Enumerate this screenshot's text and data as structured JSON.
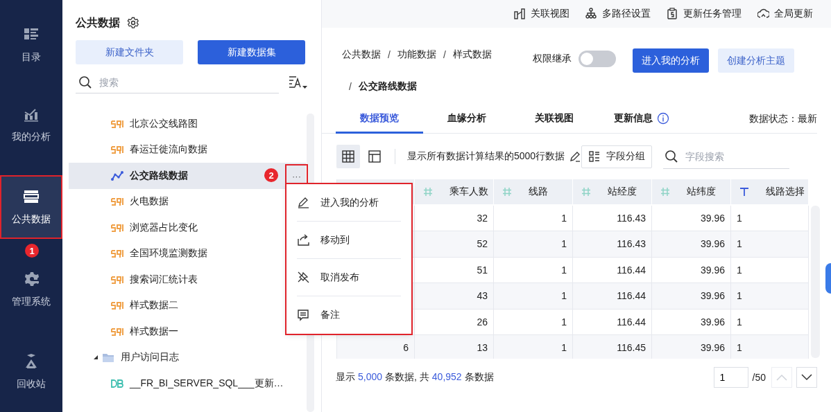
{
  "nav": [
    {
      "label": "目录",
      "selected": false,
      "highlighted": false
    },
    {
      "label": "我的分析",
      "selected": false,
      "highlighted": false
    },
    {
      "label": "公共数据",
      "selected": true,
      "highlighted": true
    },
    {
      "label": "管理系统",
      "selected": false,
      "highlighted": false,
      "badge": "1"
    },
    {
      "label": "回收站",
      "selected": false,
      "highlighted": false
    }
  ],
  "panel": {
    "title": "公共数据",
    "buttons": [
      {
        "label": "新建文件夹",
        "kind": "secondary"
      },
      {
        "label": "新建数据集",
        "kind": "primary"
      }
    ],
    "search": {
      "placeholder": "搜索"
    },
    "tree": [
      {
        "label": "北京公交线路图",
        "kind": "sql",
        "selected": false
      },
      {
        "label": "春运迁徙流向数据",
        "kind": "sql",
        "selected": false
      },
      {
        "label": "公交路线数据",
        "kind": "chart",
        "selected": true,
        "badge": "2",
        "more": "···",
        "more_highlighted": true
      },
      {
        "label": "火电数据",
        "kind": "sql",
        "selected": false
      },
      {
        "label": "浏览器占比变化",
        "kind": "sql",
        "selected": false
      },
      {
        "label": "全国环境监测数据",
        "kind": "sql",
        "selected": false
      },
      {
        "label": "搜索词汇统计表",
        "kind": "sql",
        "selected": false
      },
      {
        "label": "样式数据二",
        "kind": "sql",
        "selected": false
      },
      {
        "label": "样式数据一",
        "kind": "sql",
        "selected": false
      },
      {
        "label": "用户访问日志",
        "kind": "folder",
        "selected": false,
        "expanded": true,
        "children": [
          {
            "label": "__FR_BI_SERVER_SQL___更新…",
            "kind": "db",
            "selected": false
          }
        ]
      }
    ]
  },
  "context_menu": {
    "highlighted": true,
    "items": [
      "进入我的分析",
      "移动到",
      "取消发布",
      "备注"
    ]
  },
  "toolbar": [
    "关联视图",
    "多路径设置",
    "更新任务管理",
    "全局更新"
  ],
  "breadcrumb": [
    {
      "text": "公共数据"
    },
    {
      "sep": "/",
      "text": "功能数据"
    },
    {
      "sep": "/",
      "text": "样式数据"
    },
    {
      "sep": "/",
      "text": "公交路线数据"
    }
  ],
  "inherit": {
    "label": "权限继承",
    "on": false
  },
  "actions": [
    {
      "label": "进入我的分析",
      "kind": "primary"
    },
    {
      "label": "创建分析主题",
      "kind": "secondary"
    }
  ],
  "tabs": [
    {
      "label": "数据预览",
      "selected": true
    },
    {
      "label": "血缘分析",
      "selected": false
    },
    {
      "label": "关联视图",
      "selected": false
    },
    {
      "label": "更新信息",
      "selected": false,
      "info": true
    }
  ],
  "data_status": "数据状态：最新",
  "views": [
    {
      "selected": true
    },
    {
      "selected": false
    }
  ],
  "preview_note": "显示所有数据计算结果的5000行数据",
  "group_button": "字段分组",
  "field_search": {
    "placeholder": "字段搜索"
  },
  "table": {
    "columns": [
      {
        "label": "乘车人数",
        "kind": "number"
      },
      {
        "label": "线路",
        "kind": "number"
      },
      {
        "label": "站经度",
        "kind": "number"
      },
      {
        "label": "站纬度",
        "kind": "number"
      },
      {
        "label": "线路选择",
        "kind": "text"
      }
    ],
    "rows": [
      {
        "cells": [
          "32",
          "1",
          "116.43",
          "39.96",
          "1"
        ]
      },
      {
        "cells": [
          "52",
          "1",
          "116.43",
          "39.96",
          "1"
        ]
      },
      {
        "cells": [
          "51",
          "1",
          "116.44",
          "39.96",
          "1"
        ]
      },
      {
        "cells": [
          "43",
          "1",
          "116.44",
          "39.96",
          "1"
        ]
      },
      {
        "cells": [
          "26",
          "1",
          "116.44",
          "39.96",
          "1"
        ]
      },
      {
        "index": "6",
        "cells": [
          "13",
          "1",
          "116.45",
          "39.96",
          "1"
        ]
      }
    ]
  },
  "footer": {
    "parts": [
      {
        "text": "显示",
        "kind": "plain"
      },
      {
        "text": "5,000",
        "kind": "number"
      },
      {
        "text": "条数据, 共",
        "kind": "plain"
      },
      {
        "text": "40,952",
        "kind": "number"
      },
      {
        "text": "条数据",
        "kind": "plain"
      }
    ],
    "page": "1",
    "pages": "/50",
    "prev_disabled": true,
    "next_disabled": false
  }
}
